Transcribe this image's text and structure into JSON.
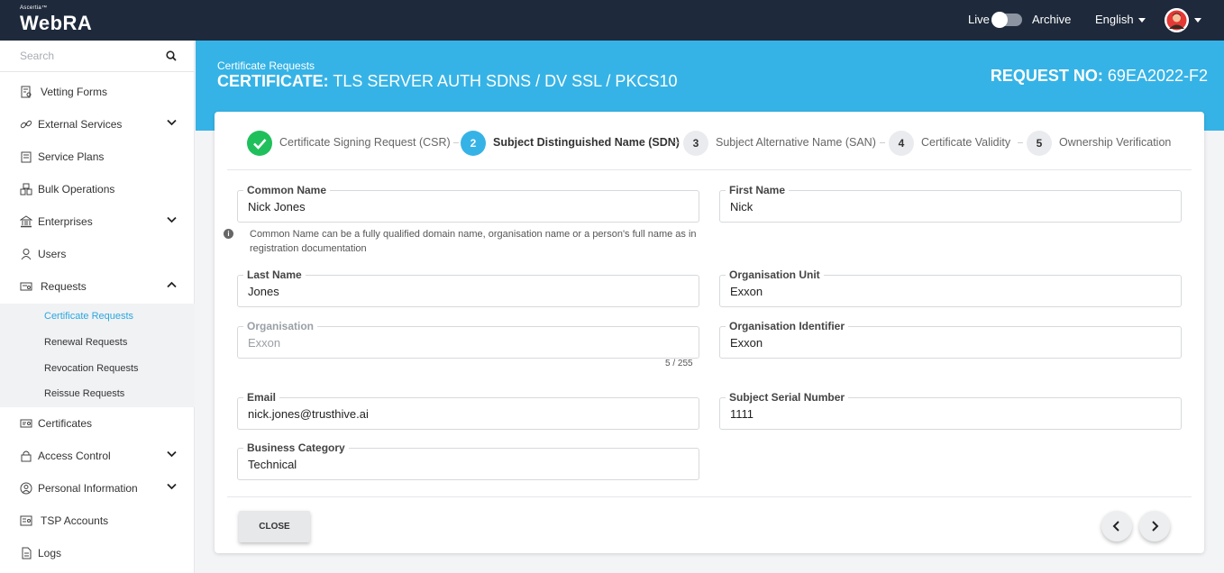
{
  "topbar": {
    "brand_small": "Ascertia™",
    "brand": "WebRA",
    "live_label": "Live",
    "archive_label": "Archive",
    "language": "English"
  },
  "sidebar": {
    "search_placeholder": "Search",
    "items": [
      {
        "label": "Vetting Forms",
        "icon": "vetting-forms-icon"
      },
      {
        "label": "External Services",
        "icon": "link-icon",
        "expandable": true
      },
      {
        "label": "Service Plans",
        "icon": "service-plans-icon"
      },
      {
        "label": "Bulk Operations",
        "icon": "bulk-operations-icon"
      },
      {
        "label": "Enterprises",
        "icon": "bank-icon",
        "expandable": true
      },
      {
        "label": "Users",
        "icon": "user-icon"
      },
      {
        "label": "Requests",
        "icon": "requests-icon",
        "expanded": true
      },
      {
        "label": "Certificates",
        "icon": "certificate-icon"
      },
      {
        "label": "Access Control",
        "icon": "lock-icon",
        "expandable": true
      },
      {
        "label": "Personal Information",
        "icon": "person-circle-icon",
        "expandable": true
      },
      {
        "label": "TSP Accounts",
        "icon": "tsp-accounts-icon"
      },
      {
        "label": "Logs",
        "icon": "logs-icon"
      }
    ],
    "sub_items": [
      {
        "label": "Certificate Requests",
        "active": true
      },
      {
        "label": "Renewal Requests"
      },
      {
        "label": "Revocation Requests"
      },
      {
        "label": "Reissue Requests"
      }
    ]
  },
  "header": {
    "breadcrumb": "Certificate Requests",
    "title_prefix": "CERTIFICATE:",
    "title": "TLS SERVER AUTH SDNS / DV SSL / PKCS10",
    "request_prefix": "REQUEST NO:",
    "request_no": "69EA2022-F2"
  },
  "steps": [
    {
      "number": "",
      "label": "Certificate Signing Request (CSR)",
      "state": "done"
    },
    {
      "number": "2",
      "label": "Subject Distinguished Name (SDN)",
      "state": "current"
    },
    {
      "number": "3",
      "label": "Subject Alternative Name (SAN)",
      "state": "pending"
    },
    {
      "number": "4",
      "label": "Certificate Validity",
      "state": "pending"
    },
    {
      "number": "5",
      "label": "Ownership Verification",
      "state": "pending"
    }
  ],
  "form": {
    "common_name": {
      "label": "Common Name",
      "value": "Nick Jones"
    },
    "common_name_hint": "Common Name can be a fully qualified domain name, organisation name or a person's full name as in registration documentation",
    "first_name": {
      "label": "First Name",
      "value": "Nick"
    },
    "last_name": {
      "label": "Last Name",
      "value": "Jones"
    },
    "org_unit": {
      "label": "Organisation Unit",
      "value": "Exxon"
    },
    "organisation": {
      "label": "Organisation",
      "value": "Exxon",
      "counter": "5 / 255"
    },
    "org_identifier": {
      "label": "Organisation Identifier",
      "value": "Exxon"
    },
    "email": {
      "label": "Email",
      "value": "nick.jones@trusthive.ai"
    },
    "subject_serial": {
      "label": "Subject Serial Number",
      "value": "1111"
    },
    "business_category": {
      "label": "Business Category",
      "value": "Technical"
    }
  },
  "footer": {
    "close_label": "CLOSE"
  },
  "colors": {
    "topbar": "#1e2a3b",
    "accent": "#36b3e6",
    "success": "#1fc05b"
  }
}
